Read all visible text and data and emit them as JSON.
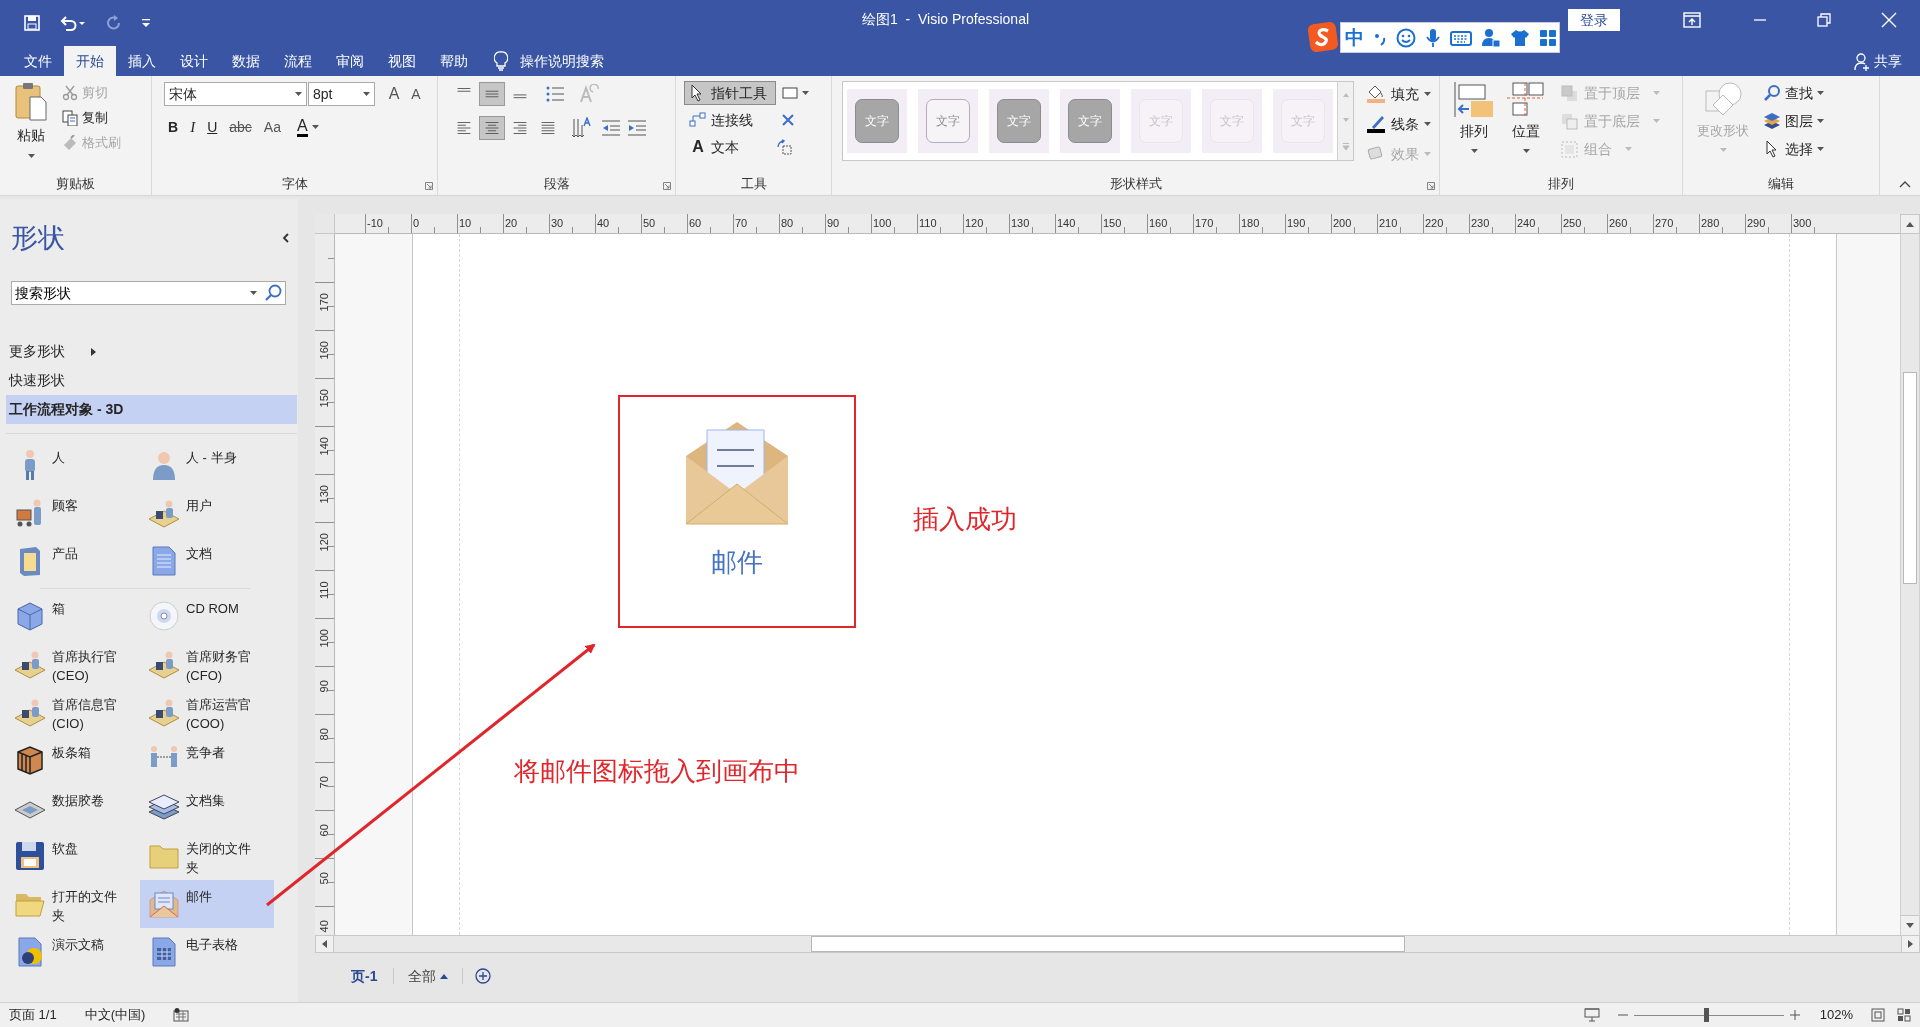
{
  "title_bar": {
    "title": "绘图1  -  Visio Professional",
    "login_button": "登录"
  },
  "ime_toolbar": {
    "mode": "中"
  },
  "menu_tabs": [
    {
      "label": "文件",
      "selected": false
    },
    {
      "label": "开始",
      "selected": true
    },
    {
      "label": "插入",
      "selected": false
    },
    {
      "label": "设计",
      "selected": false
    },
    {
      "label": "数据",
      "selected": false
    },
    {
      "label": "流程",
      "selected": false
    },
    {
      "label": "审阅",
      "selected": false
    },
    {
      "label": "视图",
      "selected": false
    },
    {
      "label": "帮助",
      "selected": false
    }
  ],
  "tell_me": "操作说明搜索",
  "share": "共享",
  "clipboard": {
    "label": "剪贴板",
    "paste": "粘贴",
    "actions": [
      {
        "label": "剪切",
        "disabled": true
      },
      {
        "label": "复制",
        "disabled": false
      },
      {
        "label": "格式刷",
        "disabled": true
      }
    ]
  },
  "font": {
    "label": "字体",
    "family": "宋体",
    "size": "8pt",
    "grow": "A",
    "shrink": "A",
    "styles": [
      "B",
      "I",
      "U",
      "abc",
      "Aa"
    ],
    "color_button": "A"
  },
  "paragraph": {
    "label": "段落",
    "vertical_align": [
      {
        "selected": false
      },
      {
        "selected": true
      },
      {
        "selected": false
      }
    ],
    "horizontal_align": [
      {
        "selected": false
      },
      {
        "selected": true
      },
      {
        "selected": false
      },
      {
        "selected": false
      }
    ]
  },
  "tools": {
    "label": "工具",
    "items": [
      {
        "label": "指针工具",
        "kind": "pointer",
        "selected": true
      },
      {
        "label": "连接线",
        "kind": "connector",
        "selected": false
      },
      {
        "label": "文本",
        "kind": "text",
        "glyph": "A",
        "selected": false
      }
    ]
  },
  "shape_styles": {
    "label": "形状样式",
    "swatches": [
      {
        "text": "文字",
        "kind": "dark"
      },
      {
        "text": "文字",
        "kind": "outline"
      },
      {
        "text": "文字",
        "kind": "dark"
      },
      {
        "text": "文字",
        "kind": "dark"
      },
      {
        "text": "文字",
        "kind": "faint"
      },
      {
        "text": "文字",
        "kind": "faint"
      },
      {
        "text": "文字",
        "kind": "faint"
      }
    ],
    "options": [
      {
        "label": "填充",
        "disabled": false
      },
      {
        "label": "线条",
        "disabled": false
      },
      {
        "label": "效果",
        "disabled": true
      }
    ]
  },
  "arrange": {
    "label": "排列",
    "big_buttons": [
      "排列",
      "位置"
    ],
    "options": [
      {
        "label": "置于顶层",
        "disabled": true
      },
      {
        "label": "置于底层",
        "disabled": true
      },
      {
        "label": "组合",
        "disabled": true
      }
    ]
  },
  "editing": {
    "label": "编辑",
    "change_shape": {
      "label": "更改形状",
      "disabled": true
    },
    "options": [
      {
        "label": "查找"
      },
      {
        "label": "图层"
      },
      {
        "label": "选择"
      }
    ]
  },
  "shapes_panel": {
    "title": "形状",
    "search": {
      "placeholder": "搜索形状"
    },
    "nav": [
      {
        "label": "更多形状",
        "kind": "submenu",
        "selected": false
      },
      {
        "label": "快速形状",
        "kind": "link",
        "selected": false
      },
      {
        "label": "工作流程对象 - 3D",
        "kind": "stencil",
        "selected": true
      }
    ],
    "sections": [
      {
        "items": [
          {
            "label": "人",
            "selected": false
          },
          {
            "label": "人 - 半身",
            "selected": false
          },
          {
            "label": "顾客",
            "selected": false
          },
          {
            "label": "用户",
            "selected": false
          },
          {
            "label": "产品",
            "selected": false
          },
          {
            "label": "文档",
            "selected": false
          }
        ]
      },
      {
        "items": [
          {
            "label": "箱",
            "selected": false
          },
          {
            "label": "CD ROM",
            "selected": false
          },
          {
            "label": "首席执行官 (CEO)",
            "selected": false
          },
          {
            "label": "首席财务官 (CFO)",
            "selected": false
          },
          {
            "label": "首席信息官 (CIO)",
            "selected": false
          },
          {
            "label": "首席运营官 (COO)",
            "selected": false
          },
          {
            "label": "板条箱",
            "selected": false
          },
          {
            "label": "竞争者",
            "selected": false
          },
          {
            "label": "数据胶卷",
            "selected": false
          },
          {
            "label": "文档集",
            "selected": false
          },
          {
            "label": "软盘",
            "selected": false
          },
          {
            "label": "关闭的文件夹",
            "selected": false
          },
          {
            "label": "打开的文件夹",
            "selected": false
          },
          {
            "label": "邮件",
            "selected": true
          },
          {
            "label": "演示文稿",
            "selected": false
          },
          {
            "label": "电子表格",
            "selected": false
          }
        ]
      }
    ]
  },
  "canvas": {
    "h_ruler": [
      "-10",
      "0",
      "10",
      "20",
      "30",
      "40",
      "50",
      "60",
      "70",
      "80",
      "90",
      "100",
      "110",
      "120",
      "130",
      "140",
      "150",
      "160",
      "170",
      "180",
      "190",
      "200",
      "210",
      "220",
      "230",
      "240",
      "250",
      "260",
      "270",
      "280",
      "290",
      "300"
    ],
    "v_ruler": [
      "170",
      "160",
      "150",
      "140",
      "130",
      "120",
      "110",
      "100",
      "90",
      "80",
      "70",
      "60",
      "50",
      "40"
    ],
    "shape": {
      "label": "邮件"
    },
    "annotations": [
      {
        "text": "插入成功"
      },
      {
        "text": "将邮件图标拖入到画布中"
      }
    ]
  },
  "page_tabs": {
    "pages": [
      {
        "label": "页-1",
        "selected": true
      }
    ],
    "all": "全部"
  },
  "status_bar": {
    "page": "页面 1/1",
    "language": "中文(中国)",
    "zoom": "102%",
    "zoom_slider": {
      "level": 0.48
    }
  }
}
